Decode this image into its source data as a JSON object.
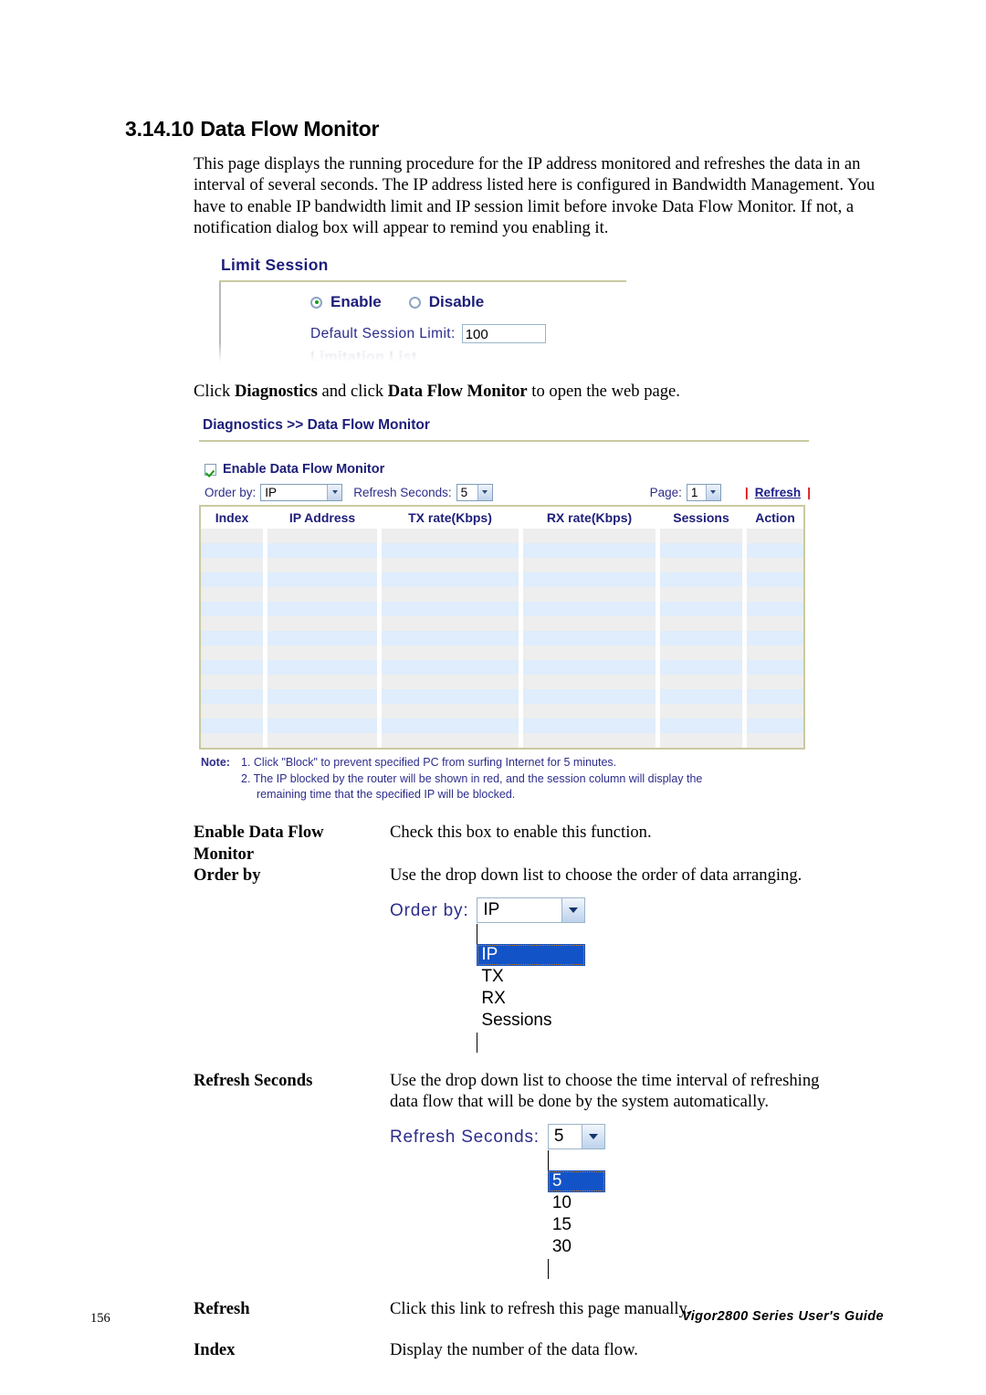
{
  "heading": {
    "number": "3.14.10",
    "title": "Data Flow Monitor"
  },
  "intro_paragraph": "This page displays the running procedure for the IP address monitored and refreshes the data in an interval of several seconds. The IP address listed here is configured in Bandwidth Management. You have to enable IP bandwidth limit and IP session limit before invoke Data Flow Monitor. If not, a notification dialog box will appear to remind you enabling it.",
  "limit_session": {
    "title": "Limit Session",
    "enable_label": "Enable",
    "disable_label": "Disable",
    "selected": "Enable",
    "session_limit_label": "Default Session Limit:",
    "session_limit_value": "100",
    "limitation_list_label": "Limitation List"
  },
  "click_instruction": {
    "prefix": "Click ",
    "bold1": "Diagnostics",
    "middle": " and click ",
    "bold2": "Data Flow Monitor",
    "suffix": " to open the web page."
  },
  "diagnostics": {
    "breadcrumb": "Diagnostics >> Data Flow Monitor",
    "enable_checkbox_label": "Enable Data Flow Monitor",
    "enable_checkbox_checked": true,
    "order_by_label": "Order by:",
    "order_by_value": "IP",
    "refresh_seconds_label": "Refresh Seconds:",
    "refresh_seconds_value": "5",
    "page_label": "Page:",
    "page_value": "1",
    "refresh_link": "Refresh",
    "separator": "|",
    "columns": [
      "Index",
      "IP Address",
      "TX rate(Kbps)",
      "RX rate(Kbps)",
      "Sessions",
      "Action"
    ],
    "row_count": 15,
    "note_label": "Note:",
    "note_items": [
      "1. Click \"Block\" to prevent specified PC from surfing Internet for 5 minutes.",
      "2. The IP blocked by the router will be shown in red, and the session column will display the",
      "remaining time that the specified IP will be blocked."
    ]
  },
  "definitions": [
    {
      "term_line1": "Enable Data Flow",
      "term_line2": "Monitor",
      "desc": "Check this box to enable this function."
    },
    {
      "term_line1": "Order by",
      "term_line2": "",
      "desc": "Use the drop down list to choose the order of data arranging."
    },
    {
      "term_line1": "Refresh Seconds",
      "term_line2": "",
      "desc_line1": "Use the drop down list to choose the time interval of refreshing",
      "desc_line2": "data flow that will be done by the system automatically."
    },
    {
      "term_line1": "Refresh",
      "term_line2": "",
      "desc": "Click this link to refresh this page manually."
    },
    {
      "term_line1": "Index",
      "term_line2": "",
      "desc": "Display the number of the data flow."
    }
  ],
  "order_by_dropdown": {
    "label": "Order by:",
    "value": "IP",
    "options": [
      "IP",
      "TX",
      "RX",
      "Sessions"
    ],
    "selected_index": 0
  },
  "refresh_seconds_dropdown": {
    "label": "Refresh Seconds:",
    "value": "5",
    "options": [
      "5",
      "10",
      "15",
      "30"
    ],
    "selected_index": 0
  },
  "footer": {
    "page_number": "156",
    "guide_text": "Vigor2800 Series User's Guide"
  },
  "colors": {
    "heading_blue": "#1d1d7a",
    "panel_border": "#c9c9a0",
    "row_odd": "#eeeeee",
    "row_even": "#dfedfc",
    "select_blue": "#1353c8",
    "red_pipe": "#e01010",
    "check_green": "#119911"
  }
}
